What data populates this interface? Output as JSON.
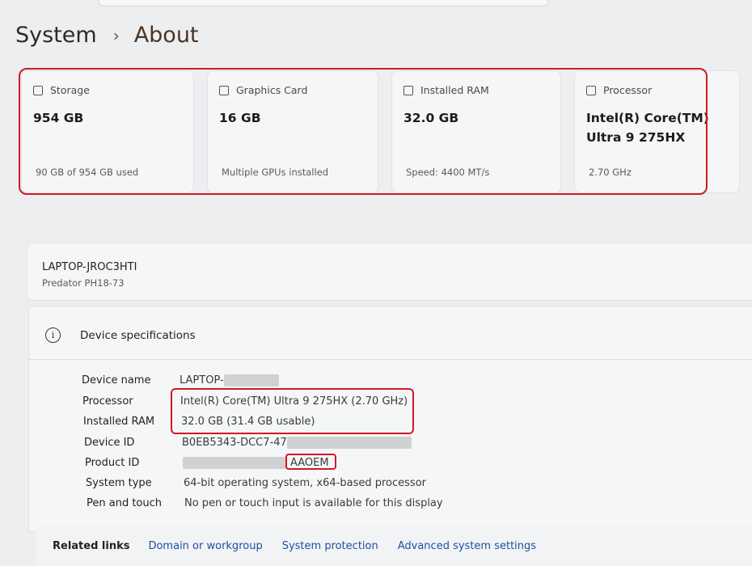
{
  "breadcrumb": {
    "parent": "System",
    "separator": "›",
    "current": "About"
  },
  "cards": [
    {
      "title": "Storage",
      "icon": "storage-icon",
      "value": "954 GB",
      "sub": "90 GB of 954 GB used"
    },
    {
      "title": "Graphics Card",
      "icon": "gpu-icon",
      "value": "16 GB",
      "sub": "Multiple GPUs installed"
    },
    {
      "title": "Installed RAM",
      "icon": "ram-icon",
      "value": "32.0 GB",
      "sub": "Speed: 4400 MT/s"
    },
    {
      "title": "Processor",
      "icon": "cpu-icon",
      "value_line1": "Intel(R) Core(TM)",
      "value_line2": "Ultra 9 275HX",
      "sub": "2.70 GHz"
    }
  ],
  "device": {
    "name": "LAPTOP-JROC3HTI",
    "model": "Predator PH18-73"
  },
  "specs": {
    "title": "Device specifications",
    "rows": [
      {
        "label": "Device name",
        "value": "LAPTOP-"
      },
      {
        "label": "Processor",
        "value": "Intel(R) Core(TM) Ultra 9 275HX (2.70 GHz)"
      },
      {
        "label": "Installed RAM",
        "value": "32.0 GB (31.4 GB usable)"
      },
      {
        "label": "Device ID",
        "value": "B0EB5343-DCC7-47"
      },
      {
        "label": "Product ID",
        "value": "AAOEM"
      },
      {
        "label": "System type",
        "value": "64-bit operating system, x64-based processor"
      },
      {
        "label": "Pen and touch",
        "value": "No pen or touch input is available for this display"
      }
    ]
  },
  "related": {
    "label": "Related links",
    "links": [
      "Domain or workgroup",
      "System protection",
      "Advanced system settings"
    ]
  },
  "colors": {
    "highlight": "#d01a24",
    "link": "#1d4fa3"
  }
}
